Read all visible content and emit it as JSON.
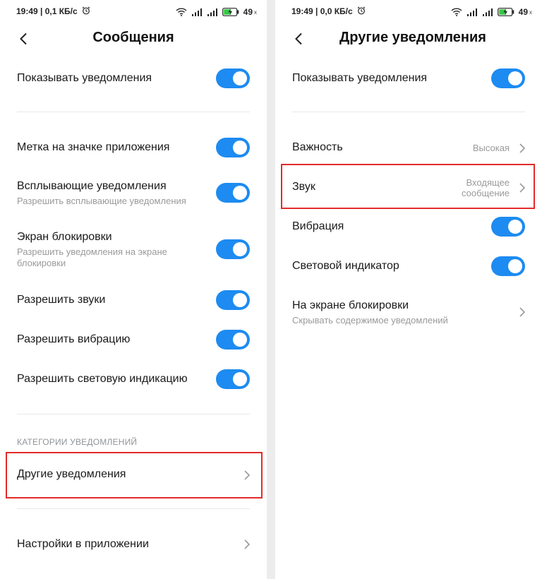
{
  "left": {
    "status": {
      "time_info": "19:49 | 0,1 КБ/с",
      "battery": "49",
      "battery_unit": "х"
    },
    "title": "Сообщения",
    "show_notifications": "Показывать уведомления",
    "badge": "Метка на значке приложения",
    "floating": {
      "title": "Всплывающие уведомления",
      "sub": "Разрешить всплывающие уведомления"
    },
    "lockscreen": {
      "title": "Экран блокировки",
      "sub": "Разрешить уведомления на экране блокировки"
    },
    "sounds": "Разрешить звуки",
    "vibration": "Разрешить вибрацию",
    "light": "Разрешить световую индикацию",
    "section_header": "КАТЕГОРИИ УВЕДОМЛЕНИЙ",
    "other_notifications": "Другие уведомления",
    "app_settings": "Настройки в приложении"
  },
  "right": {
    "status": {
      "time_info": "19:49 | 0,0 КБ/с",
      "battery": "49",
      "battery_unit": "х"
    },
    "title": "Другие уведомления",
    "show_notifications": "Показывать уведомления",
    "importance": {
      "title": "Важность",
      "value": "Высокая"
    },
    "sound": {
      "title": "Звук",
      "value_line1": "Входящее",
      "value_line2": "сообщение"
    },
    "vibration": "Вибрация",
    "indicator": "Световой индикатор",
    "lockscreen": {
      "title": "На экране блокировки",
      "sub": "Скрывать содержимое уведомлений"
    }
  },
  "colors": {
    "toggle_on": "#1d8bf1",
    "highlight": "#e52a2a",
    "background": "#ffffff"
  },
  "icons": [
    "back-arrow-icon",
    "chevron-right-icon",
    "wifi-icon",
    "signal-icon",
    "battery-charging-icon",
    "alarm-clock-icon"
  ]
}
